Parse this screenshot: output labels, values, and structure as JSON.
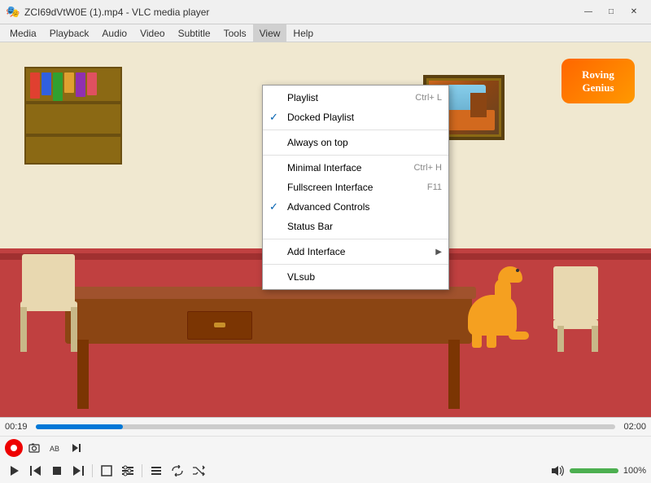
{
  "titleBar": {
    "icon": "🎭",
    "title": "ZCI69dVtW0E (1).mp4 - VLC media player",
    "minimizeBtn": "—",
    "maximizeBtn": "□",
    "closeBtn": "✕"
  },
  "menuBar": {
    "items": [
      "Media",
      "Playback",
      "Audio",
      "Video",
      "Subtitle",
      "Tools",
      "View",
      "Help"
    ]
  },
  "viewMenu": {
    "sections": [
      {
        "items": [
          {
            "label": "Playlist",
            "shortcut": "Ctrl+ L",
            "checked": false,
            "hasArrow": false
          },
          {
            "label": "Docked Playlist",
            "shortcut": "",
            "checked": true,
            "hasArrow": false
          }
        ]
      },
      {
        "items": [
          {
            "label": "Always on top",
            "shortcut": "",
            "checked": false,
            "hasArrow": false
          }
        ]
      },
      {
        "items": [
          {
            "label": "Minimal Interface",
            "shortcut": "Ctrl+ H",
            "checked": false,
            "hasArrow": false
          },
          {
            "label": "Fullscreen Interface",
            "shortcut": "F11",
            "checked": false,
            "hasArrow": false
          },
          {
            "label": "Advanced Controls",
            "shortcut": "",
            "checked": true,
            "hasArrow": false
          },
          {
            "label": "Status Bar",
            "shortcut": "",
            "checked": false,
            "hasArrow": false
          }
        ]
      },
      {
        "items": [
          {
            "label": "Add Interface",
            "shortcut": "",
            "checked": false,
            "hasArrow": true
          }
        ]
      },
      {
        "items": [
          {
            "label": "VLsub",
            "shortcut": "",
            "checked": false,
            "hasArrow": false
          }
        ]
      }
    ]
  },
  "player": {
    "currentTime": "00:19",
    "totalTime": "02:00",
    "progressPercent": 15,
    "volumePercent": 100,
    "volumeLabel": "100%"
  },
  "logo": {
    "line1": "Roving",
    "line2": "Genius"
  }
}
